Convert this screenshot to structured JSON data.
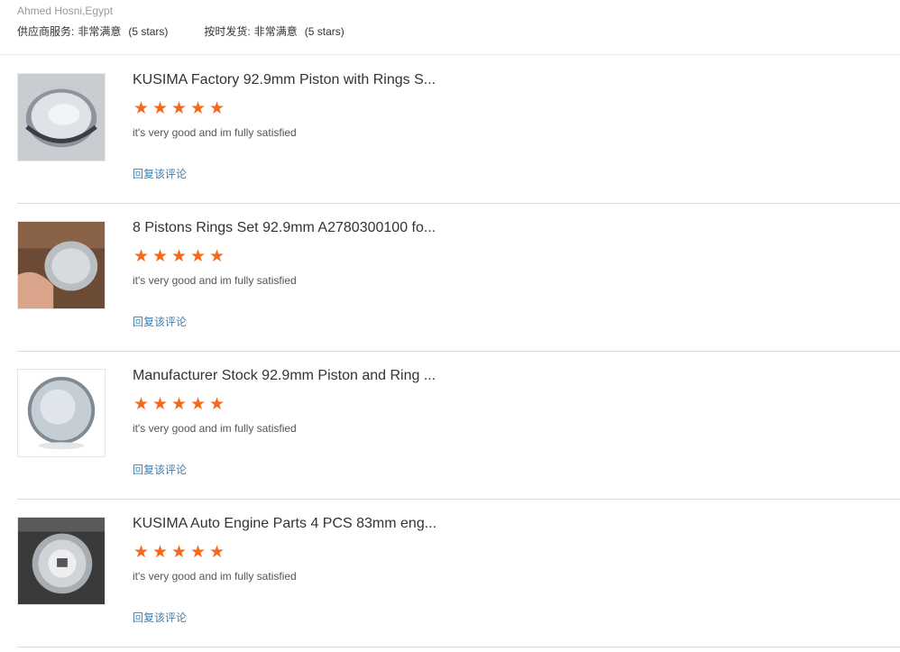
{
  "reviewer": {
    "name_location": "Ahmed Hosni,Egypt"
  },
  "ratings": [
    {
      "label": "供应商服务:",
      "value": "非常满意",
      "stars_text": "(5 stars)"
    },
    {
      "label": "按时发货:",
      "value": "非常满意",
      "stars_text": "(5 stars)"
    }
  ],
  "reviews": [
    {
      "product_title": "KUSIMA Factory 92.9mm Piston with Rings S...",
      "rating": 5,
      "comment": "it's very good and im fully satisfied",
      "reply_label": "回复该评论"
    },
    {
      "product_title": "8 Pistons Rings Set 92.9mm A2780300100 fo...",
      "rating": 5,
      "comment": "it's very good and im fully satisfied",
      "reply_label": "回复该评论"
    },
    {
      "product_title": "Manufacturer Stock 92.9mm Piston and Ring ...",
      "rating": 5,
      "comment": "it's very good and im fully satisfied",
      "reply_label": "回复该评论"
    },
    {
      "product_title": "KUSIMA Auto Engine Parts 4 PCS 83mm eng...",
      "rating": 5,
      "comment": "it's very good and im fully satisfied",
      "reply_label": "回复该评论"
    }
  ],
  "colors": {
    "star": "#f7681a",
    "reply_link": "#3d7fb0"
  }
}
